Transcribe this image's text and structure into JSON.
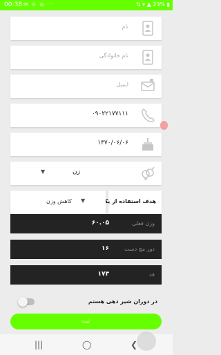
{
  "status_bar": {
    "time": "00:38",
    "battery": "23%",
    "bg_color": "#66ff00"
  },
  "form": {
    "first_name": {
      "placeholder": "نام",
      "icon": "contact-card-icon"
    },
    "last_name": {
      "placeholder": "نام خانوادگی",
      "icon": "contact-card-icon"
    },
    "email": {
      "placeholder": "ایمیل",
      "icon": "mailbox-icon"
    },
    "phone": {
      "value": "۰۹۰۲۲۱۷۷۱۱۱",
      "icon": "phone-icon"
    },
    "birthdate": {
      "value": "۱۳۷۰/۰۶/۰۶",
      "icon": "cake-icon"
    },
    "gender": {
      "value": "زن",
      "icon": "gender-icon"
    },
    "goal": {
      "label": "هدف استفاده از یکا",
      "value": "کاهش وزن"
    },
    "current_weight": {
      "label": "وزن فعلی",
      "value": "۶۰.۰۵"
    },
    "wrist": {
      "label": "دور مچ دست",
      "value": "۱۶"
    },
    "height": {
      "label": "قد",
      "value": "۱۷۳"
    },
    "breastfeeding": {
      "label": "در دوران شیر دهی هستم",
      "on": false
    }
  },
  "submit_label": "ثبت",
  "colors": {
    "accent": "#66ff00",
    "dark_field": "#232323"
  }
}
